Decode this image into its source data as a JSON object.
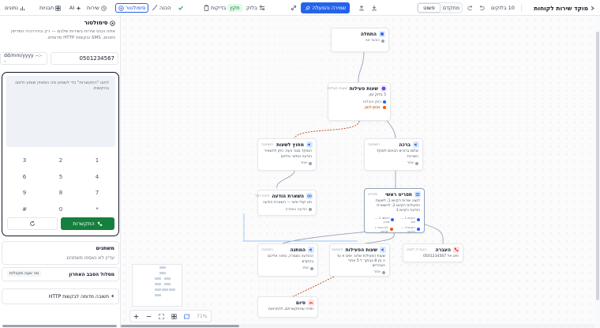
{
  "header": {
    "title": "מוקד שירות לקוחות",
    "node_count": "10 בלוקים",
    "modes": [
      "פשוט",
      "מתקדם"
    ],
    "active_mode": "פשוט",
    "save_publish": "שמירה והפעלה",
    "blocks": "בלוק",
    "checks": "בדיקות",
    "status": "תקין",
    "ready": "הכנה",
    "simulator": "סימולטור",
    "services": "שירות",
    "ai": "AI",
    "templates": "תבניות",
    "data": "נתונים"
  },
  "simulator": {
    "title": "סימולטור",
    "description": "אתה נכנס שירות בשירות שלכם — רק בהיררכיה הפדיפן נתונים, SMS ובקשות HTTP מדומים.",
    "phone_value": "0501234567",
    "date_placeholder": "dd/mm/yyyy --:--",
    "screen_hint": "לחצו \"התקשרות\" כדי לשמוע מה המאזין שומע ולחצו בהקשות.",
    "keys": [
      "1",
      "2",
      "3",
      "4",
      "5",
      "6",
      "7",
      "8",
      "9",
      "*",
      "0",
      "#"
    ],
    "call_label": "התקשרות",
    "variables_title": "משתנים",
    "variables_empty": "עדיין לא נאספו משתנים.",
    "last_route_title": "מסלול הסבב האחרון",
    "last_route_badge": "מה שעה מקבלות",
    "http_mock": "תשובה מדומה לבקשות HTTP"
  },
  "flow": {
    "nodes": [
      {
        "id": "start",
        "title": "התחלה",
        "meta": "",
        "body": "",
        "foot": "כאשר אני"
      },
      {
        "id": "hours",
        "title": "שעות פעילות",
        "meta": "שעות פעילות",
        "body": "5 בלוק זמן",
        "foot": "בזמן פעילות",
        "tag": "מחוץ לזמן"
      },
      {
        "id": "welcome",
        "title": "ברכה",
        "meta": "השמעה",
        "body": "שלום ברוכים הבאים למוקד השירות",
        "foot": "אחר"
      },
      {
        "id": "after_hours",
        "title": "מחוץ לשעות",
        "meta": "השמעה",
        "body": "המוקד סגור כעת. ניתן להשאיר הודעה ונחזור אליכם",
        "foot": "אחר"
      },
      {
        "id": "main_menu",
        "title": "תפריט ראשי",
        "meta": "תפריט",
        "body": "לנציג שירות הקישו 1, לשעות הפעילות הקישו 2, להשארת הודעה הקישו 3",
        "options": [
          "הקישו 1 — חיוג",
          "הקישו 2 — מידע",
          "הקישו 3 — הודעה",
          "לא נבחר / שגיאה"
        ]
      },
      {
        "id": "voicemail",
        "title": "השארת הודעה",
        "meta": "תיבת קול",
        "body": "תא קולי אישי — השארת הודעה",
        "foot": "הודעה נשמרה"
      },
      {
        "id": "wait",
        "title": "המתנה",
        "meta": "השמעה",
        "body": "ההודעה נשמרה, נחזור אליכם בהקדם",
        "foot": "אחר"
      },
      {
        "id": "info",
        "title": "שעות הפעילות",
        "meta": "השמעה",
        "body": "שעות הפעילות שלנו: ימים א עד ה בין 8 בבוקר ל 5 אחרי הצהריים",
        "foot": "אחר"
      },
      {
        "id": "transfer",
        "title": "העברה",
        "meta": "העברה לנציג",
        "body": "חיוג אל 0501234567",
        "foot": ""
      },
      {
        "id": "end",
        "title": "סיום",
        "meta": "",
        "body": "תודה שהתקשרתם, להתראות",
        "foot": ""
      }
    ]
  },
  "controls": {
    "zoom": "71%"
  },
  "colors": {
    "primary": "#2563eb",
    "success": "#15803d",
    "purple": "#7c3aed",
    "red": "#dc2626"
  }
}
